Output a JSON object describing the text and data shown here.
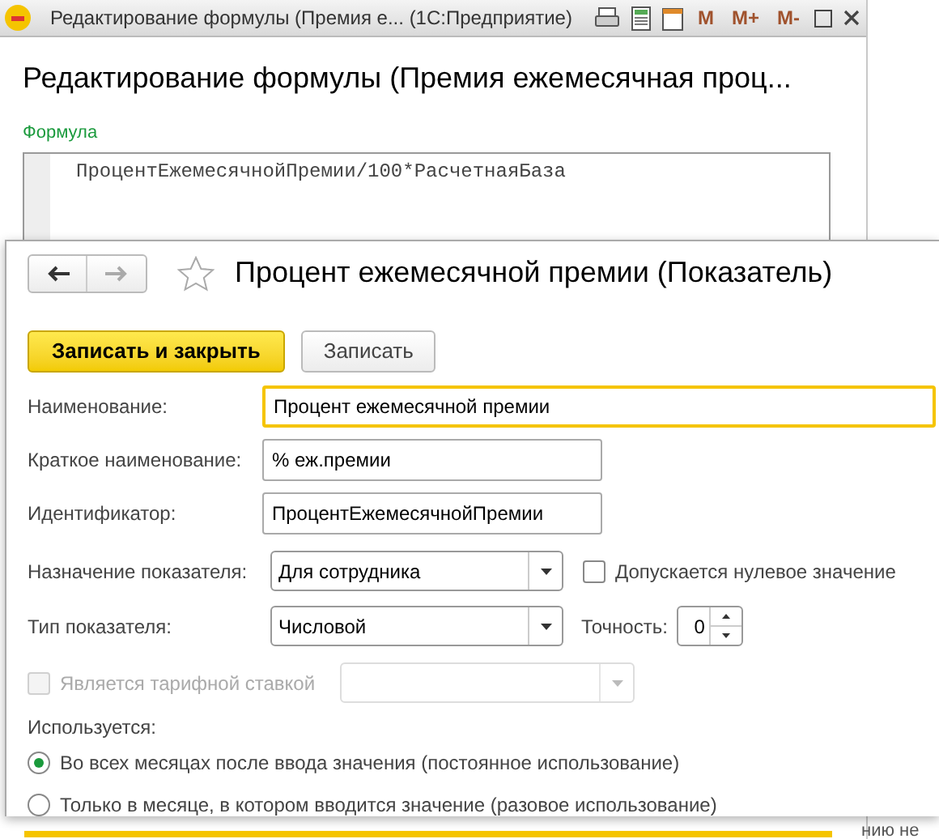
{
  "back_window": {
    "title": "Редактирование формулы (Премия е...  (1С:Предприятие)",
    "toolbar": [
      "M",
      "M+",
      "M-"
    ],
    "heading": "Редактирование формулы (Премия ежемесячная проц...",
    "formula_label": "Формула",
    "formula": "ПроцентЕжемесячнойПремии/100*РасчетнаяБаза",
    "behind_text": "нию не"
  },
  "front_window": {
    "title": "Процент ежемесячной премии (Показатель)",
    "favorite": false,
    "buttons": [
      {
        "label": "Записать и закрыть",
        "kind": "primary"
      },
      {
        "label": "Записать",
        "kind": "normal"
      }
    ],
    "fields": [
      {
        "label": "Наименование:",
        "value": "Процент ежемесячной премии",
        "focused": true
      },
      {
        "label": "Краткое наименование:",
        "value": "% еж.премии",
        "focused": false
      },
      {
        "label": "Идентификатор:",
        "value": "ПроцентЕжемесячнойПремии",
        "focused": false
      }
    ],
    "purpose": {
      "label": "Назначение показателя:",
      "value": "Для сотрудника"
    },
    "zero_allowed": {
      "label": "Допускается нулевое значение",
      "checked": false
    },
    "type": {
      "label": "Тип показателя:",
      "value": "Числовой"
    },
    "precision": {
      "label": "Точность:",
      "value": "0"
    },
    "tariff": {
      "label": "Является тарифной ставкой",
      "checked": false,
      "disabled": true
    },
    "usage": {
      "label": "Используется:",
      "options": [
        {
          "label": "Во всех месяцах после ввода значения (постоянное использование)",
          "selected": true
        },
        {
          "label": "Только в месяце, в котором вводится значение (разовое использование)",
          "selected": false
        }
      ]
    }
  }
}
